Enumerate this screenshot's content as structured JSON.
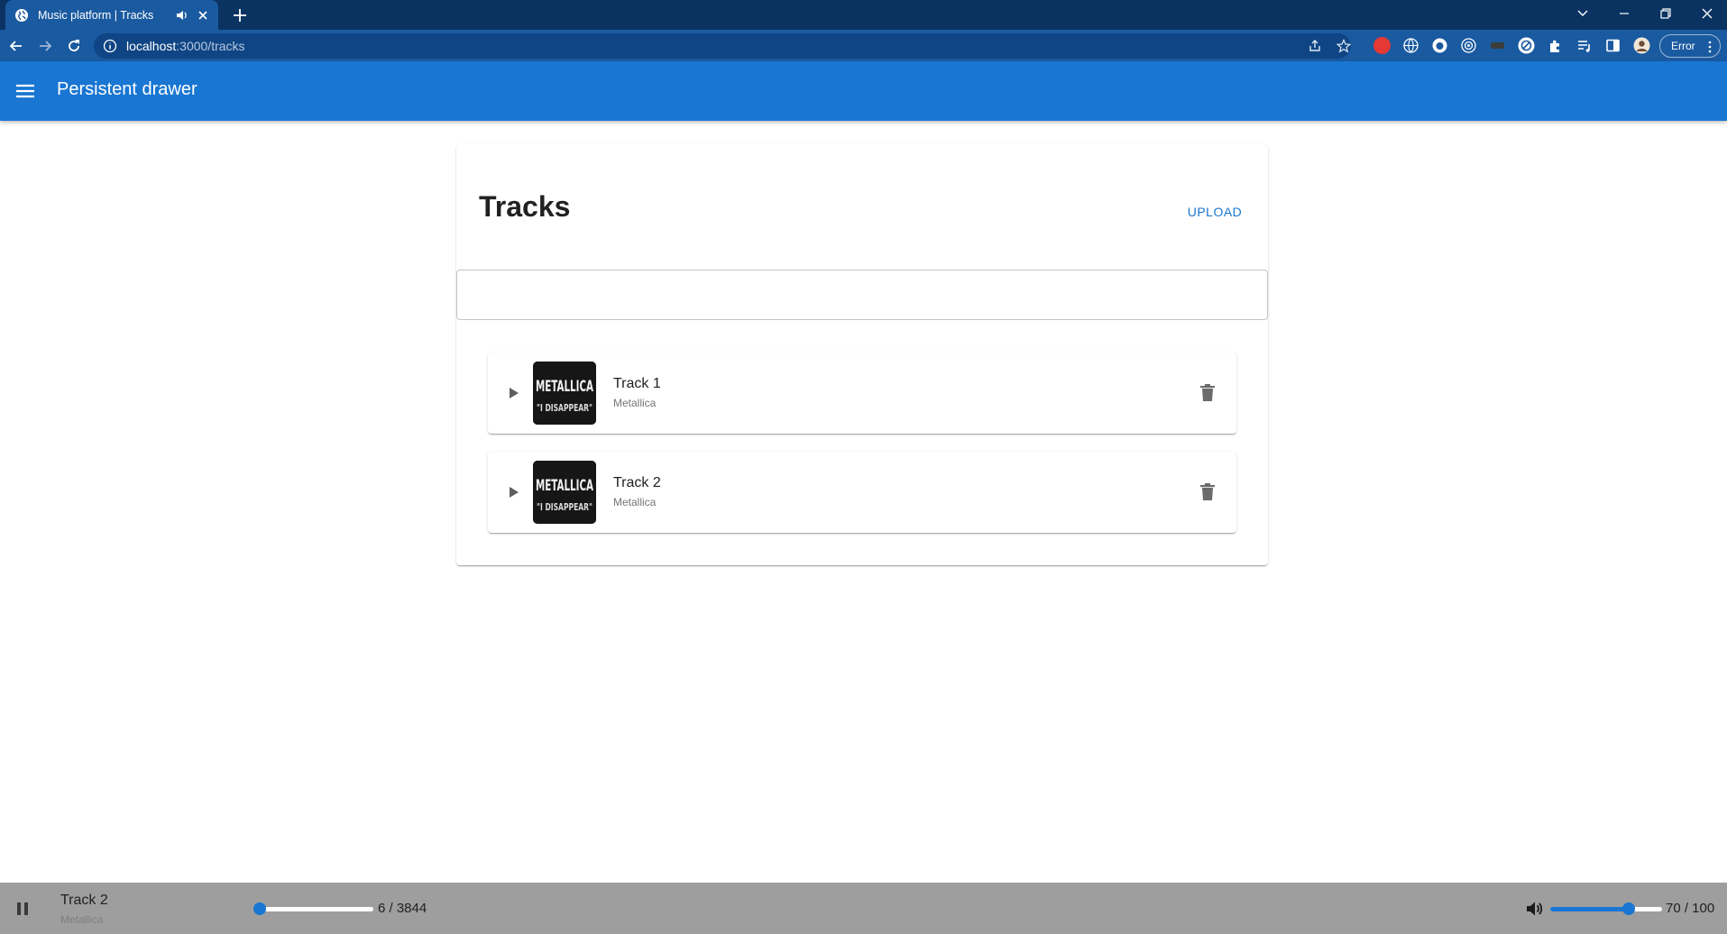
{
  "browser": {
    "tab_title": "Music platform | Tracks",
    "url_host": "localhost",
    "url_path": ":3000/tracks",
    "profile_status": "Error"
  },
  "appbar": {
    "title": "Persistent drawer"
  },
  "page": {
    "title": "Tracks",
    "upload_label": "UPLOAD",
    "search_value": "",
    "search_placeholder": ""
  },
  "tracks": [
    {
      "name": "Track 1",
      "artist": "Metallica",
      "cover_alt": "METALLICA \"I DISAPPEAR\""
    },
    {
      "name": "Track 2",
      "artist": "Metallica",
      "cover_alt": "METALLICA \"I DISAPPEAR\""
    }
  ],
  "player": {
    "title": "Track 2",
    "artist": "Metallica",
    "position": 6,
    "duration": 3844,
    "progress_text": "6 / 3844",
    "volume": 70,
    "volume_max": 100,
    "volume_text": "70 / 100",
    "state": "playing"
  },
  "colors": {
    "primary": "#1976d2",
    "chrome_dark": "#0b3362",
    "chrome_toolbar": "#1a5aa0",
    "player_bg": "#9e9e9e"
  }
}
